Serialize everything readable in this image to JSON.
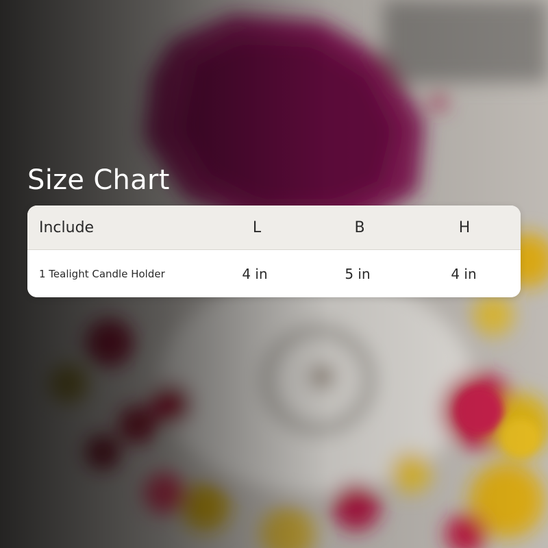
{
  "title": "Size Chart",
  "table": {
    "headers": [
      "Include",
      "L",
      "B",
      "H"
    ],
    "rows": [
      [
        "1 Tealight Candle Holder",
        "4 in",
        "5 in",
        "4 in"
      ]
    ]
  },
  "colors": {
    "header_bg": "#efede9",
    "body_bg": "#ffffff",
    "text": "#2a2a2a",
    "title": "#ffffff"
  }
}
